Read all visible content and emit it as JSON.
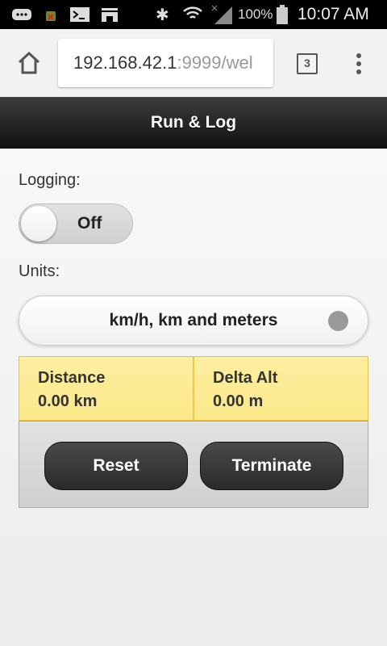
{
  "status_bar": {
    "time": "10:07 AM",
    "battery": "100%",
    "icons": [
      "messages-icon",
      "android-debug-icon",
      "terminal-icon",
      "store-icon",
      "bluetooth-icon",
      "wifi-icon",
      "signal-icon",
      "battery-icon"
    ]
  },
  "browser": {
    "url_host": "192.168.42.1",
    "url_rest": ":9999/wel",
    "tab_count": "3"
  },
  "header": {
    "title": "Run & Log"
  },
  "logging": {
    "label": "Logging:",
    "toggle_state": "Off"
  },
  "units": {
    "label": "Units:",
    "selected": "km/h, km and meters"
  },
  "stats": [
    {
      "label": "Distance",
      "value": "0.00 km"
    },
    {
      "label": "Delta Alt",
      "value": "0.00 m"
    }
  ],
  "buttons": {
    "reset": "Reset",
    "terminate": "Terminate"
  }
}
